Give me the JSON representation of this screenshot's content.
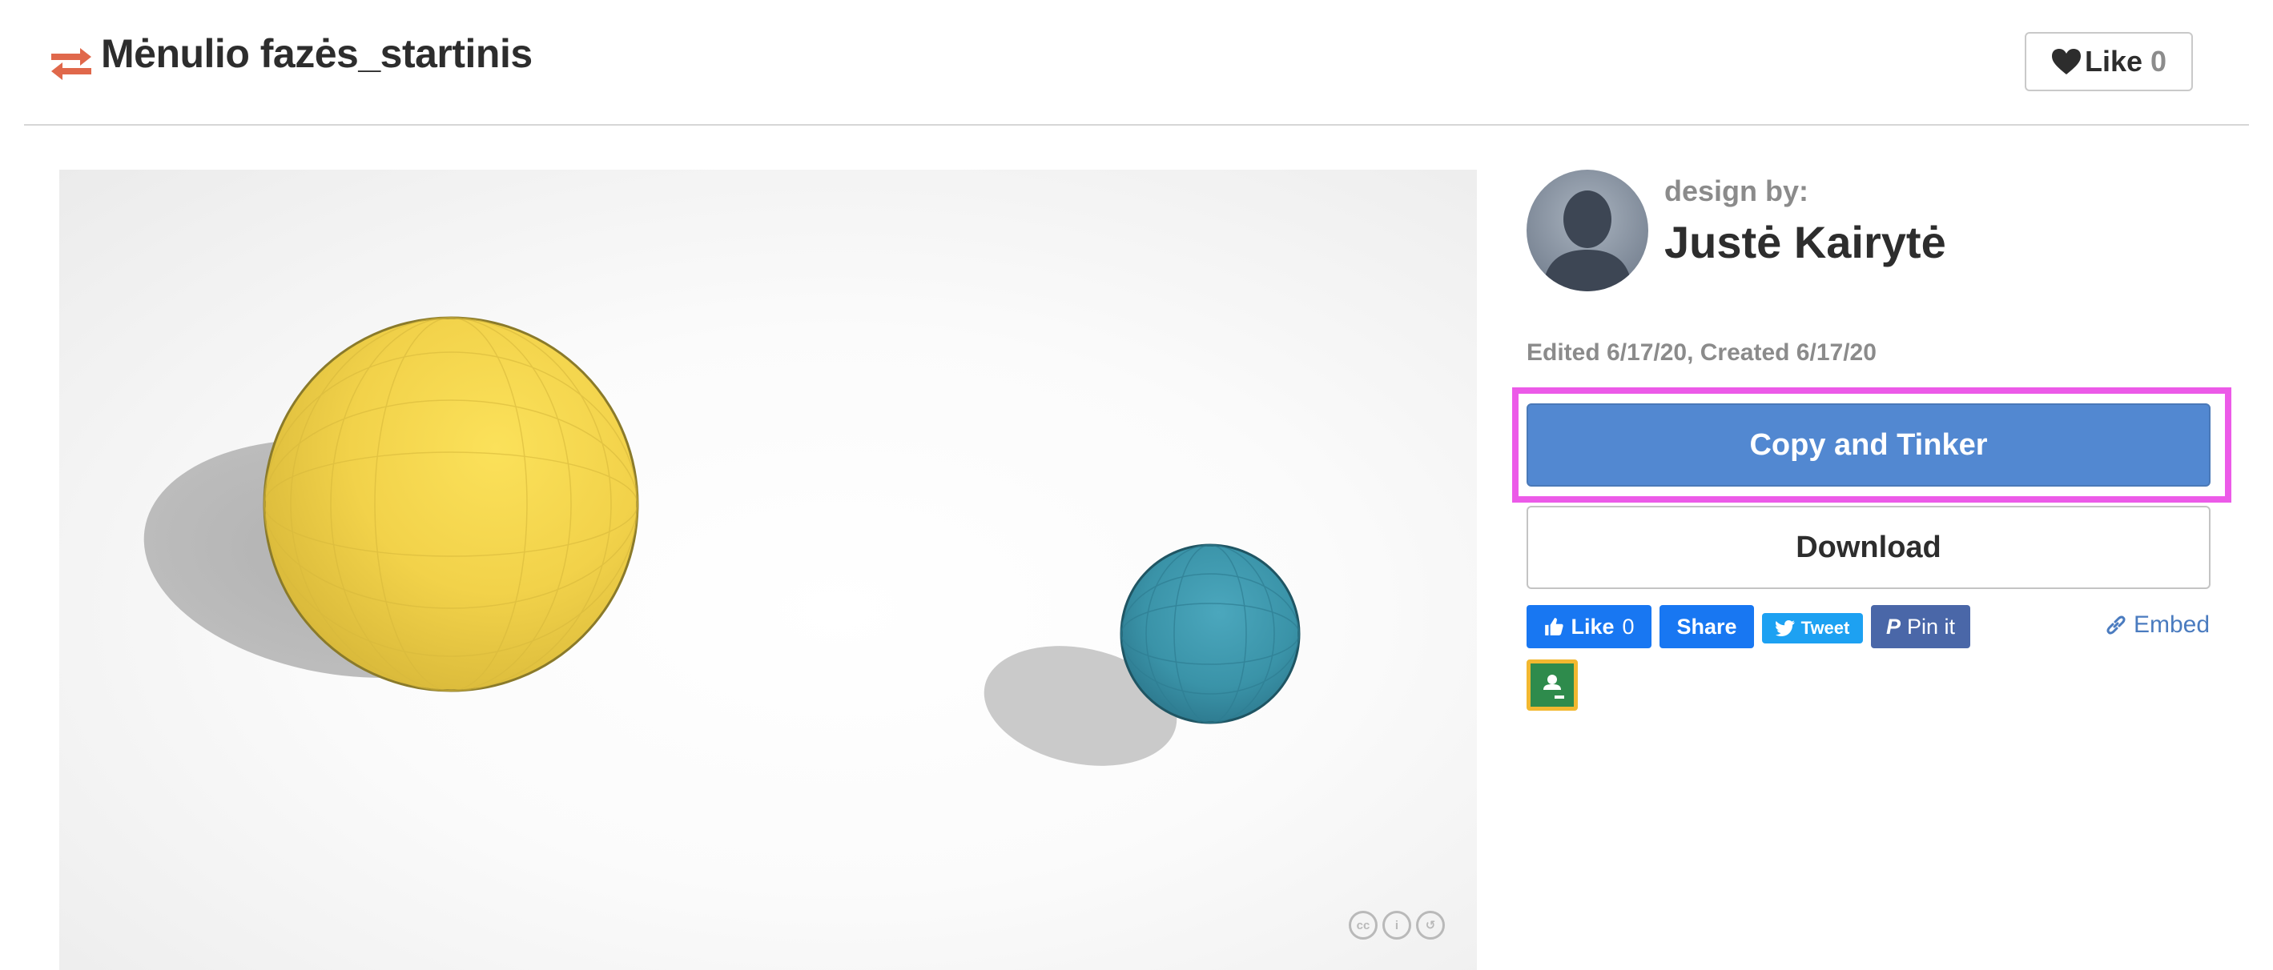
{
  "header": {
    "title": "Mėnulio fazės_startinis",
    "remix_icon": "remix-arrows-icon",
    "like_label": "Like",
    "like_count": "0"
  },
  "viewer": {
    "license_icons": [
      "cc",
      "by",
      "sa"
    ]
  },
  "author": {
    "design_by_label": "design by:",
    "name": "Justė Kairytė",
    "avatar_icon": "default-person-avatar"
  },
  "meta": {
    "dates": "Edited 6/17/20, Created 6/17/20"
  },
  "actions": {
    "copy_label": "Copy and Tinker",
    "download_label": "Download"
  },
  "social": {
    "fb_like_label": "Like",
    "fb_like_count": "0",
    "fb_share_label": "Share",
    "tweet_label": "Tweet",
    "pin_label": "Pin it",
    "embed_label": "Embed",
    "classroom_icon": "google-classroom-icon"
  },
  "colors": {
    "primary_button": "#5288d1",
    "highlight": "#ec5ae8",
    "sun": "#f4d548",
    "earth": "#3a93a8",
    "remix_icon": "#e0684b"
  }
}
